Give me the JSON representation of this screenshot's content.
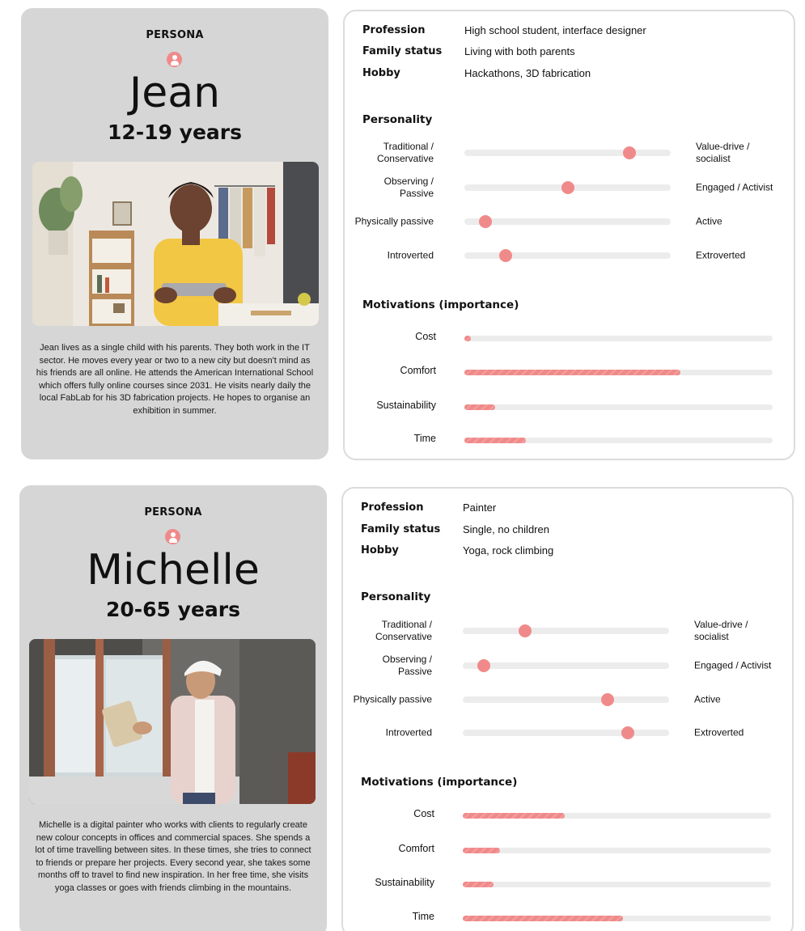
{
  "personas": [
    {
      "label": "PERSONA",
      "name": "Jean",
      "age": "12-19 years",
      "bio": "Jean lives as a single child with his parents. They both work in the IT sector. He moves every year or two to a new city but doesn't mind as his friends are all online. He attends the American International School which offers fully online courses since 2031. He visits nearly daily the local FabLab for his 3D fabrication projects. He hopes to organise an exhibition in summer.",
      "profession_key": "Profession",
      "profession": "High school student, interface designer",
      "family_key": "Family status",
      "family": "Living with both parents",
      "hobby_key": "Hobby",
      "hobby": "Hackathons, 3D fabrication",
      "personality_title": "Personality",
      "traits": [
        {
          "left": "Traditional / Conservative",
          "right": "Value-drive / socialist",
          "value": 0.8
        },
        {
          "left": "Observing / Passive",
          "right": "Engaged / Activist",
          "value": 0.5
        },
        {
          "left": "Physically passive",
          "right": "Active",
          "value": 0.1
        },
        {
          "left": "Introverted",
          "right": "Extroverted",
          "value": 0.2
        }
      ],
      "motivations_title": "Motivations (importance)",
      "motivations": [
        {
          "label": "Cost",
          "value": 0.02
        },
        {
          "label": "Comfort",
          "value": 0.7
        },
        {
          "label": "Sustainability",
          "value": 0.1
        },
        {
          "label": "Time",
          "value": 0.2
        }
      ],
      "accent_color": "#f08a8a"
    },
    {
      "label": "PERSONA",
      "name": "Michelle",
      "age": "20-65 years",
      "bio": "Michelle is a digital painter who works with clients to regularly create new colour concepts in offices and commercial spaces. She spends a lot of time travelling between sites. In these times, she tries to connect to friends or prepare her projects. Every second year, she takes some months off to travel to find new inspiration. In her free time, she visits yoga classes or goes with friends climbing in the mountains.",
      "profession_key": "Profession",
      "profession": "Painter",
      "family_key": "Family status",
      "family": "Single, no children",
      "hobby_key": "Hobby",
      "hobby": "Yoga, rock climbing",
      "personality_title": "Personality",
      "traits": [
        {
          "left": "Traditional / Conservative",
          "right": "Value-drive / socialist",
          "value": 0.3
        },
        {
          "left": "Observing / Passive",
          "right": "Engaged / Activist",
          "value": 0.1
        },
        {
          "left": "Physically passive",
          "right": "Active",
          "value": 0.7
        },
        {
          "left": "Introverted",
          "right": "Extroverted",
          "value": 0.8
        }
      ],
      "motivations_title": "Motivations (importance)",
      "motivations": [
        {
          "label": "Cost",
          "value": 0.33
        },
        {
          "label": "Comfort",
          "value": 0.12
        },
        {
          "label": "Sustainability",
          "value": 0.1
        },
        {
          "label": "Time",
          "value": 0.52
        }
      ],
      "accent_color": "#f08a8a"
    }
  ]
}
